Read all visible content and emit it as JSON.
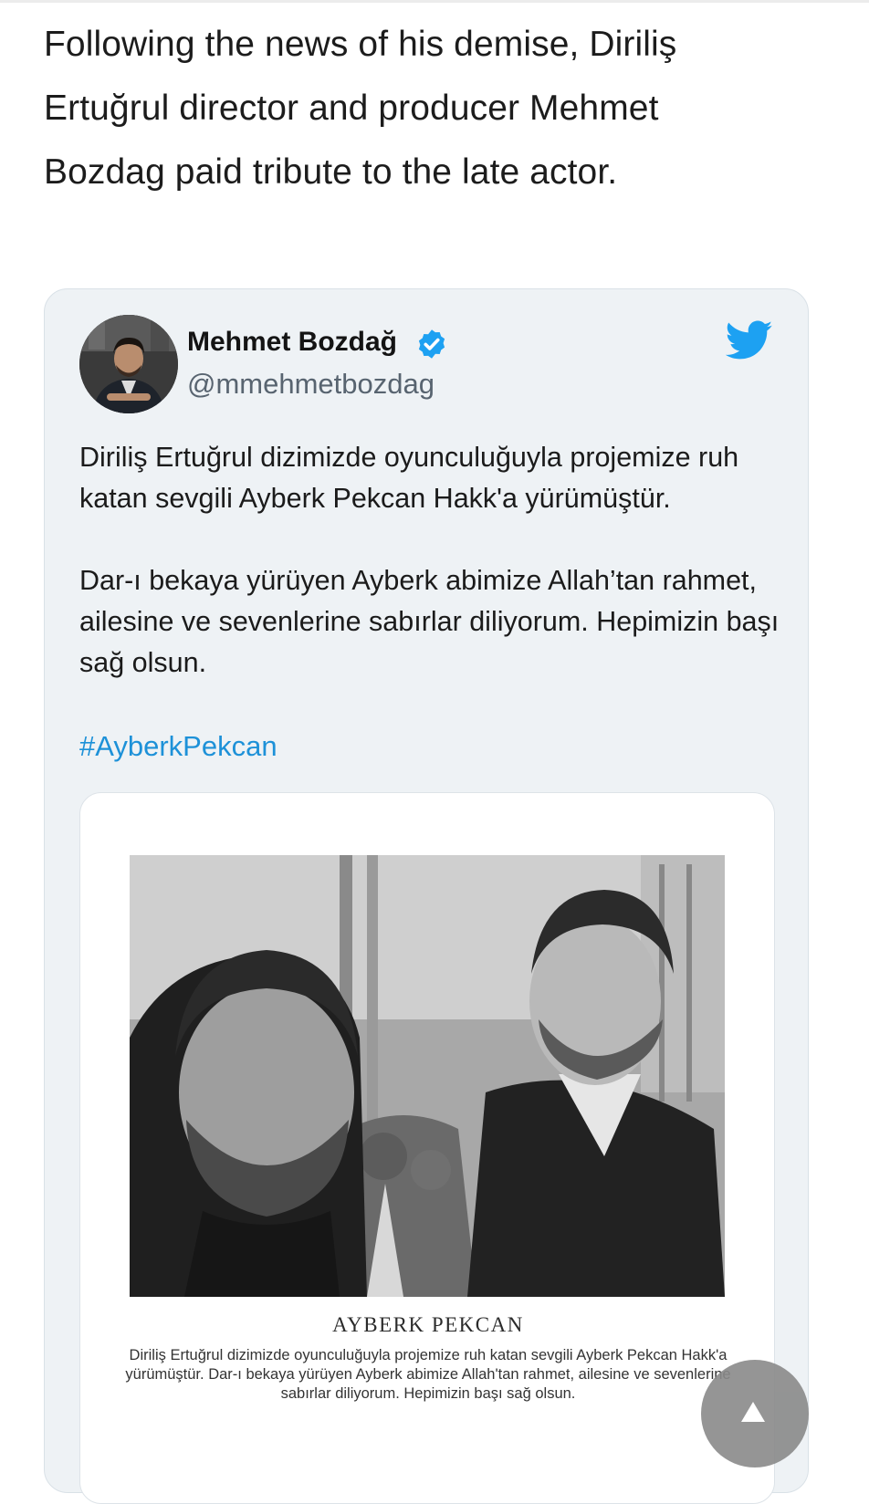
{
  "article": {
    "paragraph": "Following the news of his demise, Diriliş Ertuğrul director and producer Mehmet Bozdag paid tribute to the late actor."
  },
  "tweet": {
    "author_name": "Mehmet Bozdağ",
    "author_handle": "@mmehmetbozdag",
    "verified_icon": "verified-badge-icon",
    "platform_icon": "twitter-bird-icon",
    "paragraph_1": "Diriliş Ertuğrul dizimizde oyunculuğuyla projemize ruh katan sevgili Ayberk Pekcan Hakk'a yürümüştür.",
    "paragraph_2": "Dar-ı bekaya yürüyen Ayberk abimize Allah’tan rahmet, ailesine ve sevenlerine sabırlar diliyorum. Hepimizin başı sağ olsun.",
    "hashtag": "#AyberkPekcan",
    "media": {
      "memorial_name": "AYBERK PEKCAN",
      "memorial_text": "Diriliş Ertuğrul dizimizde oyunculuğuyla projemize ruh katan sevgili Ayberk Pekcan Hakk'a yürümüştür. Dar-ı bekaya yürüyen Ayberk abimize Allah'tan rahmet, ailesine ve sevenlerine sabırlar diliyorum. Hepimizin başı sağ olsun."
    }
  },
  "colors": {
    "link": "#1d91d8",
    "twitter_blue": "#1da1f2",
    "card_background": "#eef2f5"
  },
  "controls": {
    "scroll_up_icon": "arrow-up-icon"
  }
}
